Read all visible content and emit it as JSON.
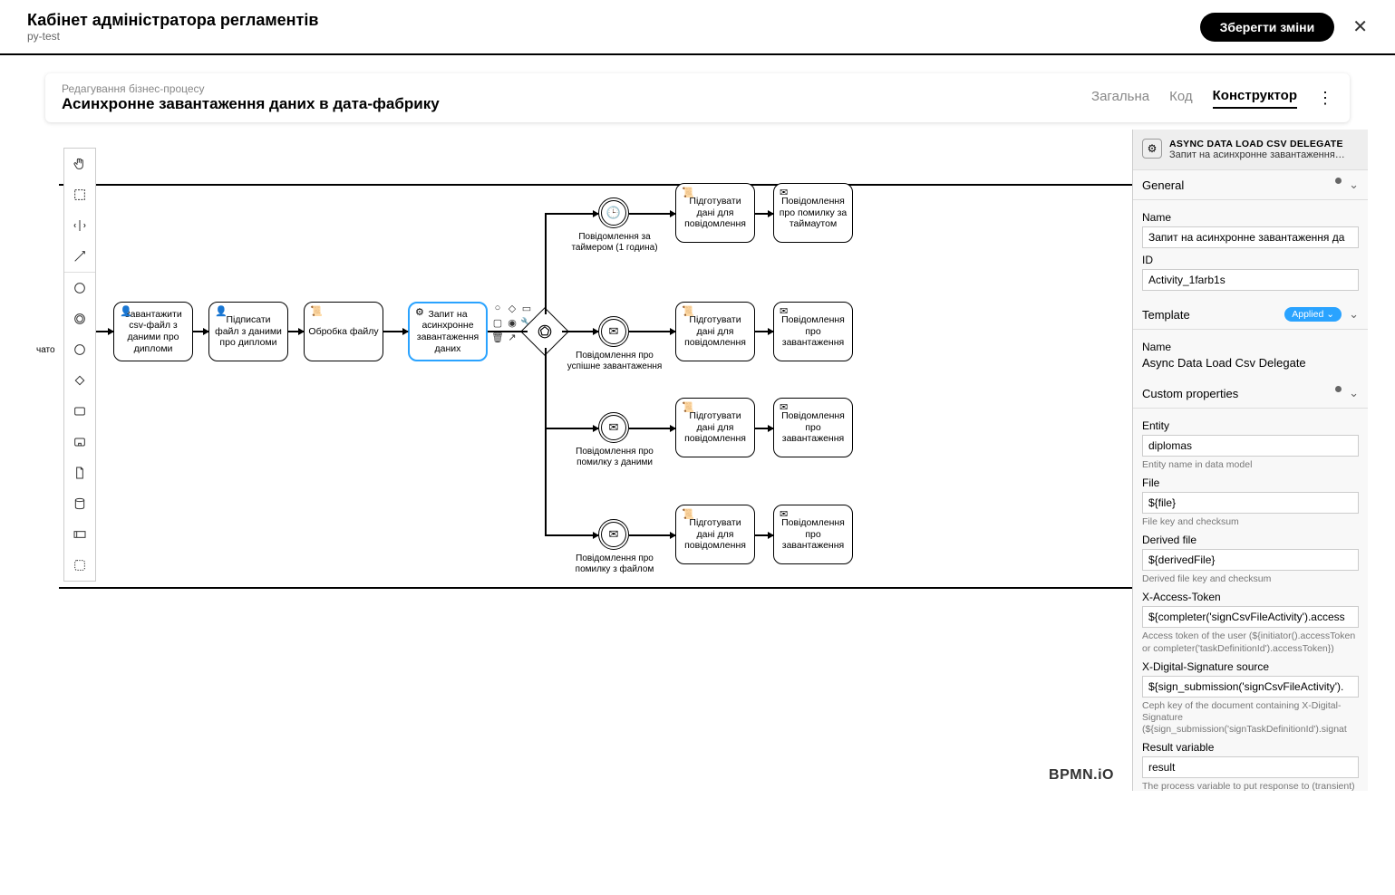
{
  "header": {
    "title": "Кабінет адміністратора регламентів",
    "subtitle": "py-test",
    "save": "Зберегти зміни"
  },
  "editor": {
    "crumb": "Редагування бізнес-процесу",
    "title": "Асинхронне завантаження даних в дата-фабрику",
    "tabs": {
      "general": "Загальна",
      "code": "Код",
      "constructor": "Конструктор"
    }
  },
  "starter_label": "чато",
  "tasks": {
    "load": "Завантажити csv-файл з даними про дипломи",
    "sign": "Підписати файл з даними про дипломи",
    "process": "Обробка файлу",
    "request": "Запит на асинхронне завантаження даних",
    "prep1": "Підготувати дані для повідомлення",
    "notify_timeout": "Повідомлення про помилку за таймаутом",
    "prep2": "Підготувати дані для повідомлення",
    "notify_load2": "Повідомлення про завантаження",
    "prep3": "Підготувати дані для повідомлення",
    "notify_load3": "Повідомлення про завантаження",
    "prep4": "Підготувати дані для повідомлення",
    "notify_load4": "Повідомлення про завантаження"
  },
  "events": {
    "timer": "Повідомлення за таймером (1 година)",
    "success": "Повідомлення про успішне завантаження",
    "err_data": "Повідомлення про помилку з даними",
    "err_file": "Повідомлення про помилку з файлом"
  },
  "panel": {
    "head_title": "ASYNC DATA LOAD CSV DELEGATE",
    "head_sub": "Запит на асинхронне завантаження…",
    "general": "General",
    "name_lbl": "Name",
    "name_val": "Запит на асинхронне завантаження да",
    "id_lbl": "ID",
    "id_val": "Activity_1farb1s",
    "template": "Template",
    "applied": "Applied",
    "tpl_name_lbl": "Name",
    "tpl_name_val": "Async Data Load Csv Delegate",
    "custom": "Custom properties",
    "entity_lbl": "Entity",
    "entity_val": "diplomas",
    "entity_hint": "Entity name in data model",
    "file_lbl": "File",
    "file_val": "${file}",
    "file_hint": "File key and checksum",
    "dfile_lbl": "Derived file",
    "dfile_val": "${derivedFile}",
    "dfile_hint": "Derived file key and checksum",
    "xat_lbl": "X-Access-Token",
    "xat_val": "${completer('signCsvFileActivity').access",
    "xat_hint": "Access token of the user (${initiator().accessToken or completer('taskDefinitionId').accessToken})",
    "xds_lbl": "X-Digital-Signature source",
    "xds_val": "${sign_submission('signCsvFileActivity').",
    "xds_hint": "Ceph key of the document containing X-Digital-Signature (${sign_submission('signTaskDefinitionId').signat",
    "res_lbl": "Result variable",
    "res_val": "result",
    "res_hint": "The process variable to put response to (transient)"
  },
  "logo": "BPMN.iO"
}
